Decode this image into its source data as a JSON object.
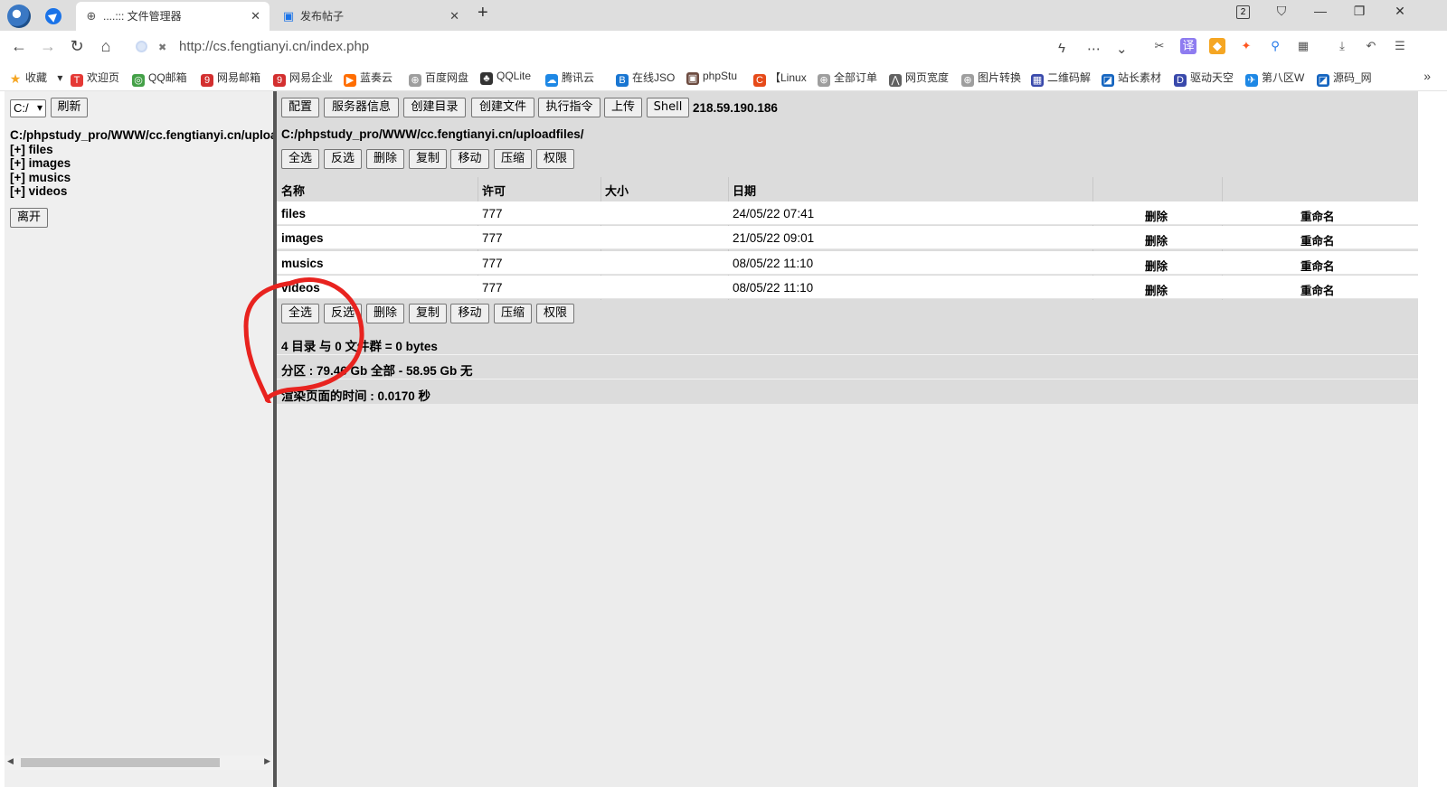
{
  "browser": {
    "active_tab_title": "....::: 文件管理器",
    "inactive_tab_title": "发布帖子",
    "tab_count": "2",
    "url": "http://cs.fengtianyi.cn/index.php",
    "bookmarks": [
      {
        "label": "收藏",
        "color": "#f5a623",
        "glyph": "★"
      },
      {
        "label": "欢迎页",
        "color": "#e53935",
        "glyph": "T"
      },
      {
        "label": "QQ邮箱",
        "color": "#43a047",
        "glyph": "◎"
      },
      {
        "label": "网易邮箱",
        "color": "#d32f2f",
        "glyph": "9"
      },
      {
        "label": "网易企业",
        "color": "#d32f2f",
        "glyph": "9"
      },
      {
        "label": "蓝奏云",
        "color": "#ff6d00",
        "glyph": "▶"
      },
      {
        "label": "百度网盘",
        "color": "#9e9e9e",
        "glyph": "⊕"
      },
      {
        "label": "QQLite",
        "color": "#333333",
        "glyph": "♣"
      },
      {
        "label": "腾讯云",
        "color": "#1e88e5",
        "glyph": "☁"
      },
      {
        "label": "在线JSO",
        "color": "#1976d2",
        "glyph": "B"
      },
      {
        "label": "phpStu",
        "color": "#6d4c41",
        "glyph": "▣"
      },
      {
        "label": "【Linux",
        "color": "#e64a19",
        "glyph": "C"
      },
      {
        "label": "全部订单",
        "color": "#9e9e9e",
        "glyph": "⊕"
      },
      {
        "label": "网页宽度",
        "color": "#616161",
        "glyph": "⋀"
      },
      {
        "label": "图片转换",
        "color": "#9e9e9e",
        "glyph": "⊕"
      },
      {
        "label": "二维码解",
        "color": "#3949ab",
        "glyph": "▦"
      },
      {
        "label": "站长素材",
        "color": "#1565c0",
        "glyph": "◪"
      },
      {
        "label": "驱动天空",
        "color": "#3949ab",
        "glyph": "D"
      },
      {
        "label": "第八区W",
        "color": "#1e88e5",
        "glyph": "✈"
      },
      {
        "label": "源码_网",
        "color": "#1565c0",
        "glyph": "◪"
      }
    ]
  },
  "left": {
    "drive": "C:/",
    "refresh_label": "刷新",
    "path": "C:/phpstudy_pro/WWW/cc.fengtianyi.cn/uploadfiles/",
    "tree": [
      "[+] files",
      "[+] images",
      "[+] musics",
      "[+] videos"
    ],
    "leave_label": "离开"
  },
  "toolbar": {
    "buttons": [
      "配置",
      "服务器信息",
      "创建目录",
      "创建文件",
      "执行指令",
      "上传",
      "Shell"
    ],
    "ip": "218.59.190.186"
  },
  "current_path": "C:/phpstudy_pro/WWW/cc.fengtianyi.cn/uploadfiles/",
  "actions": [
    "全选",
    "反选",
    "删除",
    "复制",
    "移动",
    "压缩",
    "权限"
  ],
  "table": {
    "headers": [
      "名称",
      "许可",
      "大小",
      "日期"
    ],
    "rows": [
      {
        "name": "files",
        "perm": "777",
        "size": "",
        "date": "24/05/22 07:41",
        "delete": "删除",
        "rename": "重命名"
      },
      {
        "name": "images",
        "perm": "777",
        "size": "",
        "date": "21/05/22 09:01",
        "delete": "删除",
        "rename": "重命名"
      },
      {
        "name": "musics",
        "perm": "777",
        "size": "",
        "date": "08/05/22 11:10",
        "delete": "删除",
        "rename": "重命名"
      },
      {
        "name": "videos",
        "perm": "777",
        "size": "",
        "date": "08/05/22 11:10",
        "delete": "删除",
        "rename": "重命名"
      }
    ]
  },
  "status": {
    "summary": "4 目录 与 0 文件群 = 0 bytes",
    "partition": "分区 : 79.46 Gb 全部 - 58.95 Gb 无",
    "render_time": "渲染页面的时间 : 0.0170 秒"
  },
  "annotation_color": "#e8231f"
}
